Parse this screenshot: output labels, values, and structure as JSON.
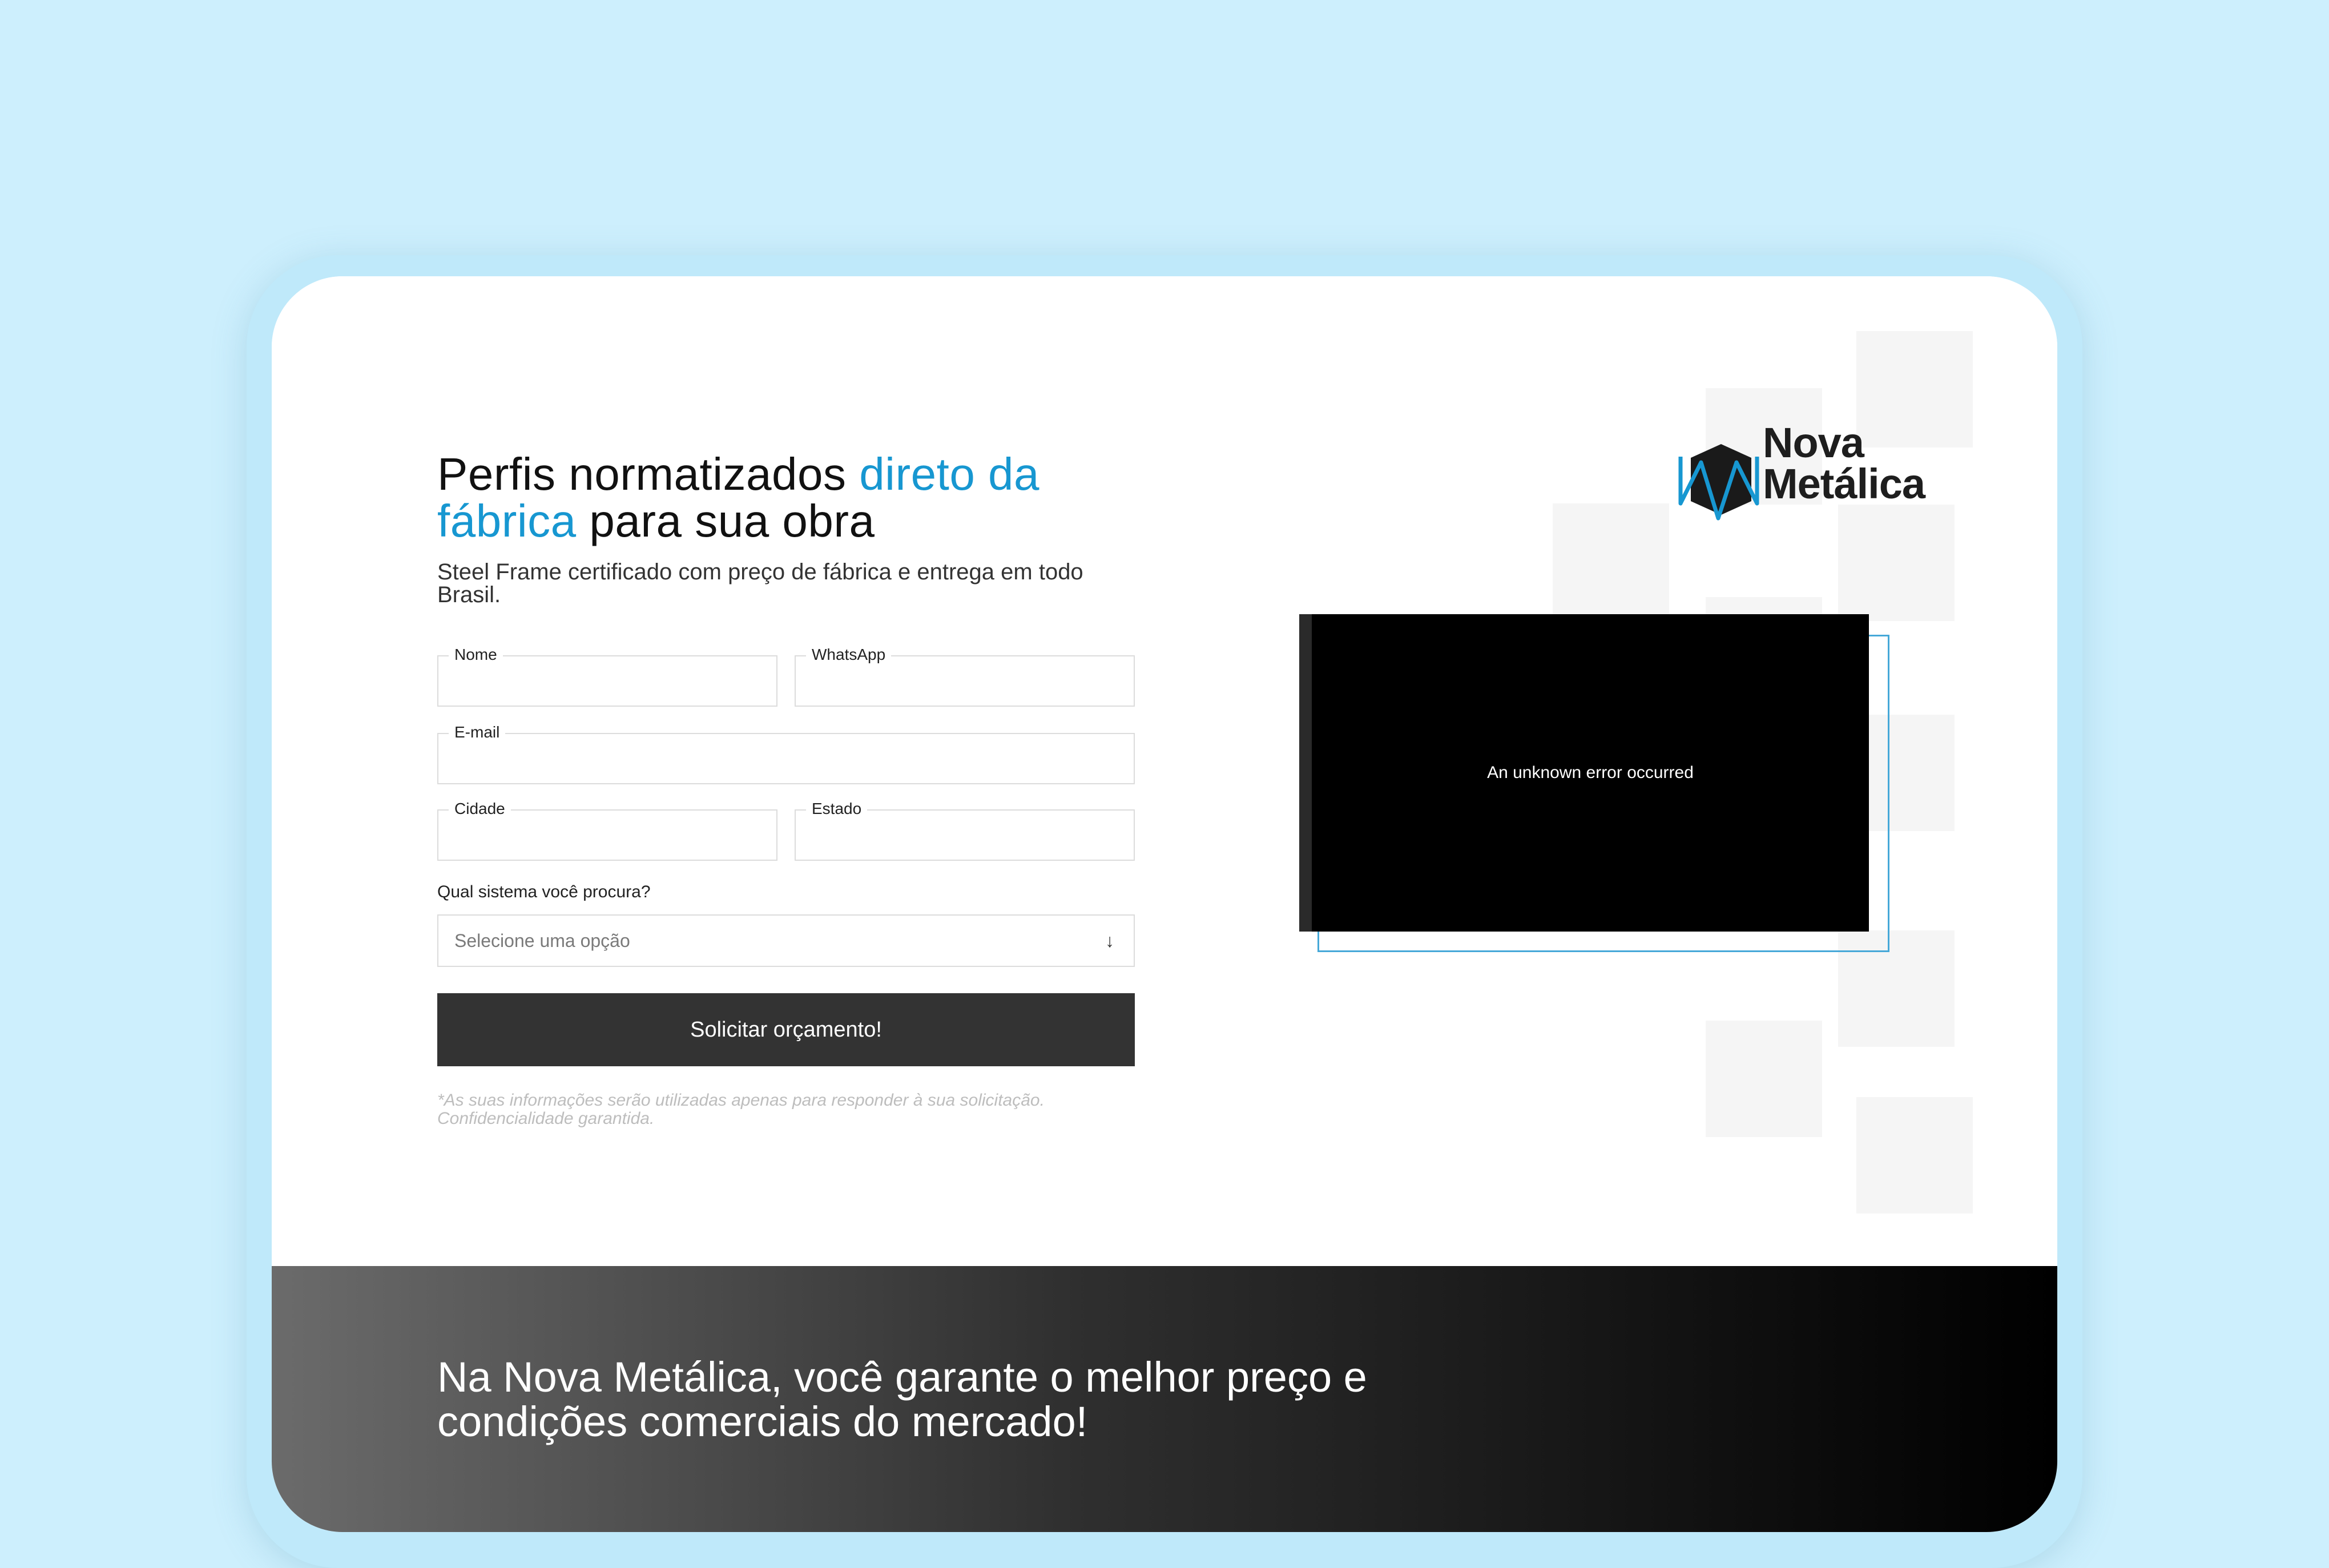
{
  "hero": {
    "headline_part1": "Perfis normatizados ",
    "headline_accent1": "direto da",
    "headline_accent2": "fábrica",
    "headline_part2": " para sua obra",
    "subheadline": "Steel Frame certificado com preço de fábrica e entrega em todo Brasil."
  },
  "form": {
    "name_label": "Nome",
    "whatsapp_label": "WhatsApp",
    "email_label": "E-mail",
    "city_label": "Cidade",
    "state_label": "Estado",
    "system_question": "Qual sistema você procura?",
    "system_placeholder": "Selecione uma opção",
    "submit_label": "Solicitar orçamento!",
    "disclaimer": "*As suas informações serão utilizadas apenas para responder à sua solicitação. Confidencialidade garantida."
  },
  "logo": {
    "line1": "Nova",
    "line2": "Metálica"
  },
  "video": {
    "error_message": "An unknown error occurred"
  },
  "banner": {
    "text": "Na Nova Metálica, você garante o melhor preço e condições comerciais do mercado!"
  },
  "colors": {
    "accent": "#1797d1",
    "background": "#cdeffd",
    "button": "#333333"
  }
}
